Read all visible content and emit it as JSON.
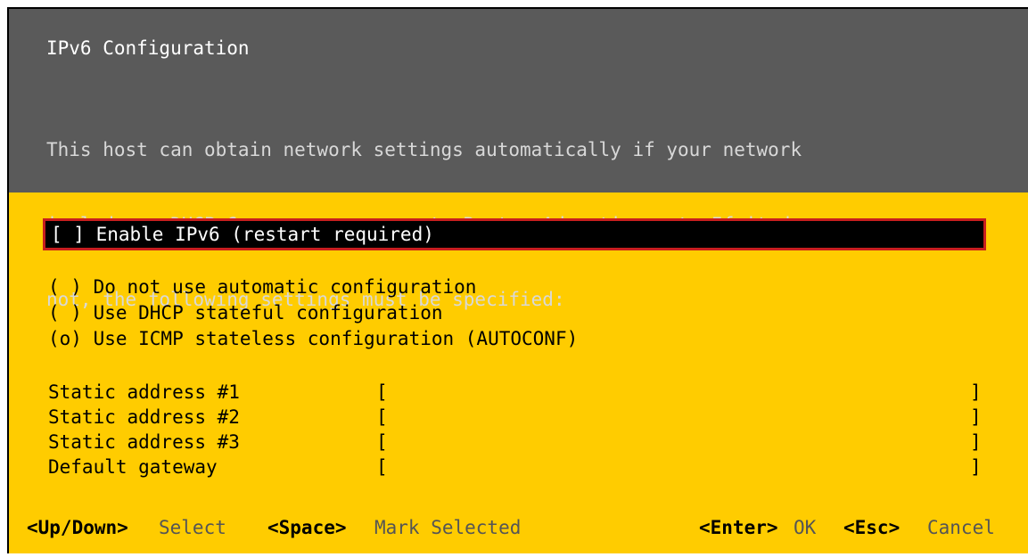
{
  "dialog": {
    "title": "IPv6 Configuration",
    "description": [
      "This host can obtain network settings automatically if your network",
      "includes a DHCPv6 server or supports Router Advertisement. If it does",
      "not, the following settings must be specified:"
    ]
  },
  "enable_ipv6": {
    "text": "[ ] Enable IPv6 (restart required)",
    "checked": false
  },
  "options": [
    {
      "text": "( ) Do not use automatic configuration",
      "selected": false
    },
    {
      "text": "( ) Use DHCP stateful configuration",
      "selected": false
    },
    {
      "text": "(o) Use ICMP stateless configuration (AUTOCONF)",
      "selected": true
    }
  ],
  "fields": [
    {
      "label": "Static address #1",
      "value": ""
    },
    {
      "label": "Static address #2",
      "value": ""
    },
    {
      "label": "Static address #3",
      "value": ""
    },
    {
      "label": "Default gateway",
      "value": ""
    }
  ],
  "footer": {
    "updown_key": "<Up/Down>",
    "updown_action": "Select",
    "space_key": "<Space>",
    "space_action": "Mark Selected",
    "enter_key": "<Enter>",
    "enter_action": "OK",
    "esc_key": "<Esc>",
    "esc_action": "Cancel"
  },
  "colors": {
    "background": "#ffcc00",
    "header": "#5a5a5a",
    "highlight": "#000000",
    "focus_border": "#c81e1e"
  }
}
